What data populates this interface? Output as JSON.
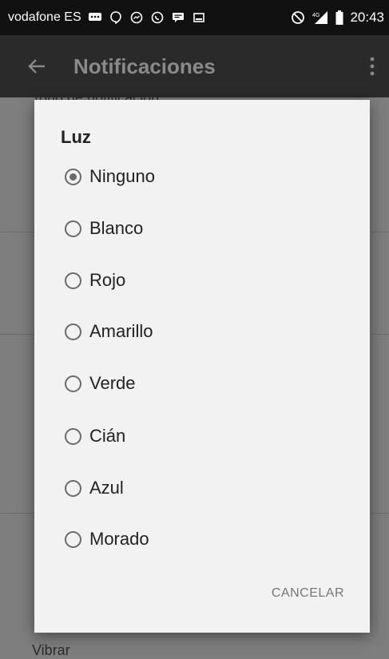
{
  "status_bar": {
    "carrier": "vodafone ES",
    "network": "4G",
    "time": "20:43"
  },
  "app_bar": {
    "title": "Notificaciones"
  },
  "background": {
    "top_row_label": "Tono de notificación",
    "bottom_row_label": "Vibrar"
  },
  "dialog": {
    "title": "Luz",
    "options": [
      {
        "label": "Ninguno",
        "selected": true
      },
      {
        "label": "Blanco",
        "selected": false
      },
      {
        "label": "Rojo",
        "selected": false
      },
      {
        "label": "Amarillo",
        "selected": false
      },
      {
        "label": "Verde",
        "selected": false
      },
      {
        "label": "Cián",
        "selected": false
      },
      {
        "label": "Azul",
        "selected": false
      },
      {
        "label": "Morado",
        "selected": false
      }
    ],
    "cancel_label": "CANCELAR"
  }
}
